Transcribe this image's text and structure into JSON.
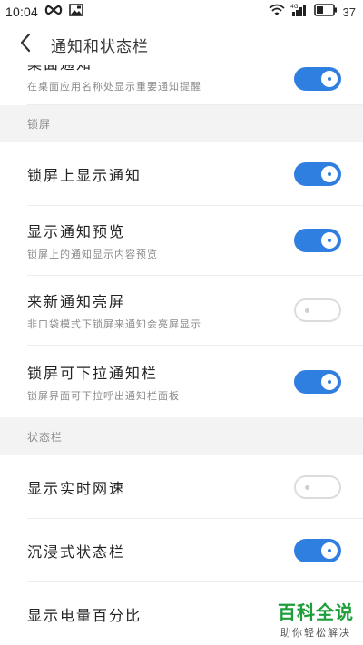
{
  "status_bar": {
    "time": "10:04",
    "battery": "37",
    "icons": [
      "infinity-icon",
      "image-notification-icon",
      "wifi-icon",
      "signal-4g-icon",
      "battery-icon"
    ]
  },
  "header": {
    "title": "通知和状态栏",
    "back_icon": "chevron-left-icon"
  },
  "top_partial": {
    "title": "桌面通知",
    "subtitle": "在桌面应用名称处显示重要通知提醒",
    "enabled": true
  },
  "sections": [
    {
      "label": "锁屏",
      "items": [
        {
          "title": "锁屏上显示通知",
          "subtitle": "",
          "enabled": true
        },
        {
          "title": "显示通知预览",
          "subtitle": "锁屏上的通知显示内容预览",
          "enabled": true
        },
        {
          "title": "来新通知亮屏",
          "subtitle": "非口袋模式下锁屏来通知会亮屏显示",
          "enabled": false
        },
        {
          "title": "锁屏可下拉通知栏",
          "subtitle": "锁屏界面可下拉呼出通知栏面板",
          "enabled": true
        }
      ]
    },
    {
      "label": "状态栏",
      "items": [
        {
          "title": "显示实时网速",
          "subtitle": "",
          "enabled": false
        },
        {
          "title": "沉浸式状态栏",
          "subtitle": "",
          "enabled": true
        },
        {
          "title": "显示电量百分比",
          "subtitle": "",
          "enabled": null
        }
      ]
    }
  ],
  "watermark": {
    "main": "百科全说",
    "sub": "助你轻松解决"
  },
  "colors": {
    "toggle_on": "#2f7fe0",
    "section_bg": "#f3f3f3",
    "watermark_green": "#1e9e3a"
  }
}
